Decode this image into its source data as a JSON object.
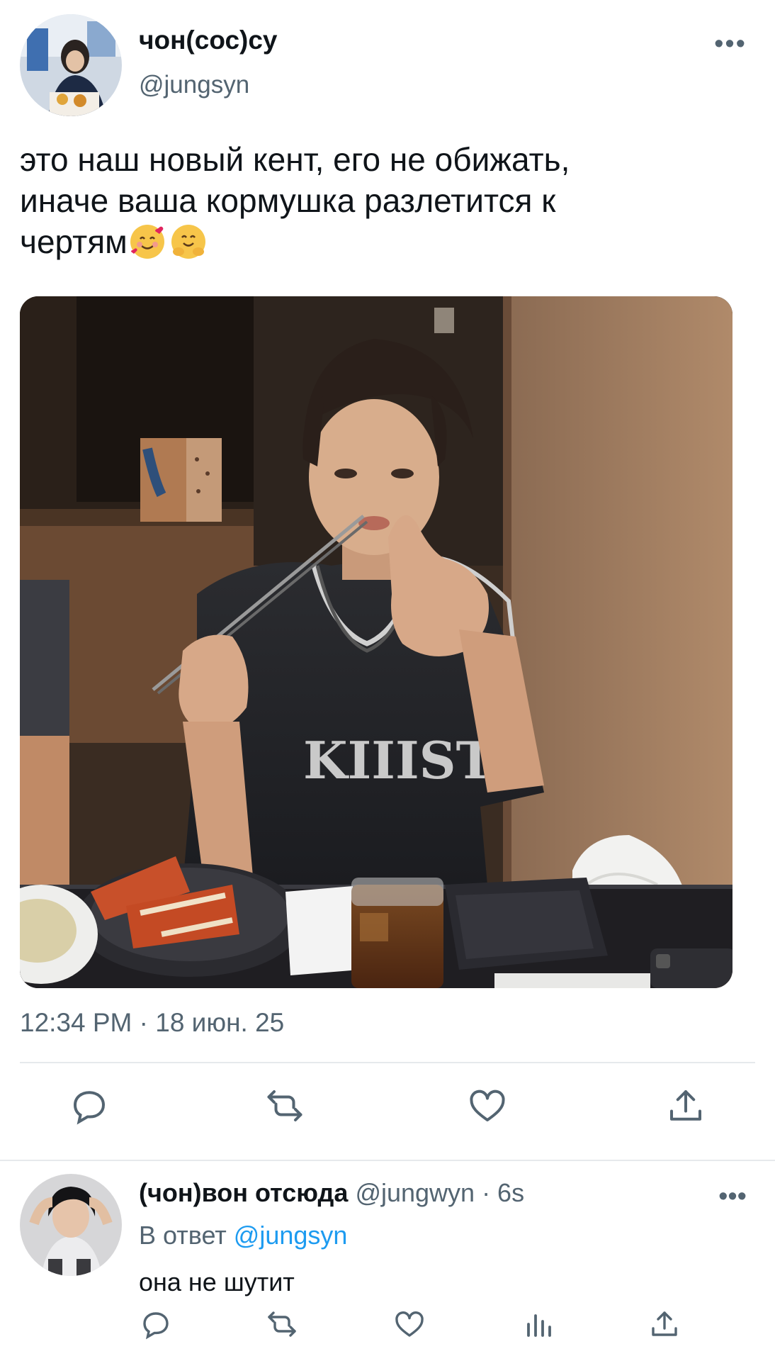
{
  "tweet": {
    "display_name": "чон(сос)су",
    "handle": "@jungsyn",
    "more_label": "•••",
    "text_line1": "это наш новый кент, его не обижать,",
    "text_line2": "иначе ваша кормушка разлетится к",
    "text_line3": "чертям",
    "emojis": [
      "smiling-face-with-hearts",
      "hugging-face"
    ],
    "timestamp": "12:34 PM · 18 июн. 25",
    "actions": [
      "reply-icon",
      "retweet-icon",
      "like-icon",
      "share-icon"
    ]
  },
  "reply": {
    "display_name": "(чон)вон отсюда",
    "meta": "@jungwyn · 6s",
    "more_label": "•••",
    "reply_prefix": "В ответ",
    "reply_to": "@jungsyn",
    "text": "она не шутит",
    "actions": [
      "reply-icon",
      "retweet-icon",
      "like-icon",
      "analytics-icon",
      "share-icon"
    ]
  },
  "colors": {
    "text_primary": "#0f1419",
    "text_secondary": "#536471",
    "link": "#1d9bf0",
    "divider": "#e6e9ec"
  }
}
